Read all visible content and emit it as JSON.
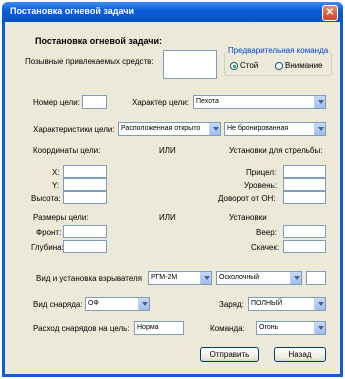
{
  "window": {
    "title": "Постановка огневой задачи",
    "close_glyph": "✕"
  },
  "heading": "Постановка огневой задачи:",
  "callsigns": {
    "label": "Позывные привлекаемых средств:",
    "value": ""
  },
  "preliminary_command": {
    "title": "Предварительная команда",
    "option_stop": "Стой",
    "option_attention": "Внимание",
    "selected": "Стой"
  },
  "target_number": {
    "label": "Номер цели:",
    "value": ""
  },
  "target_character": {
    "label": "Характер цели:",
    "value": "Пехота"
  },
  "target_characteristics": {
    "label": "Характеристики цели:",
    "value1": "Расположенная открыто",
    "value2": "Не бронированная"
  },
  "coords": {
    "title": "Координаты цели:",
    "x_label": "X:",
    "y_label": "Y:",
    "height_label": "Высота:"
  },
  "or_label_1": "ИЛИ",
  "firing_settings": {
    "title": "Установки для стрельбы:",
    "sight_label": "Прицел:",
    "level_label": "Уровень:",
    "turn_label": "Доворот от ОН:"
  },
  "sizes": {
    "title": "Размеры цели:",
    "front_label": "Фронт:",
    "depth_label": "Глубина:"
  },
  "or_label_2": "ИЛИ",
  "settings": {
    "title": "Установки",
    "fan_label": "Веер:",
    "jump_label": "Скачек:"
  },
  "fuse": {
    "label": "Вид и установка взрывателя",
    "type": "РГМ-2М",
    "setting": "Осколочный",
    "extra": ""
  },
  "shell_type": {
    "label": "Вид снаряда:",
    "value": "ОФ"
  },
  "charge": {
    "label": "Заряд:",
    "value": "ПОЛНЫЙ"
  },
  "consumption": {
    "label": "Расход снарядов на цель:",
    "value": "Норма"
  },
  "command": {
    "label": "Команда:",
    "value": "Огонь"
  },
  "buttons": {
    "send": "Отправить",
    "back": "Назад"
  },
  "colors": {
    "titlebar": "#0a5fd8",
    "client": "#ece9d8",
    "group_title": "#0046d5"
  }
}
